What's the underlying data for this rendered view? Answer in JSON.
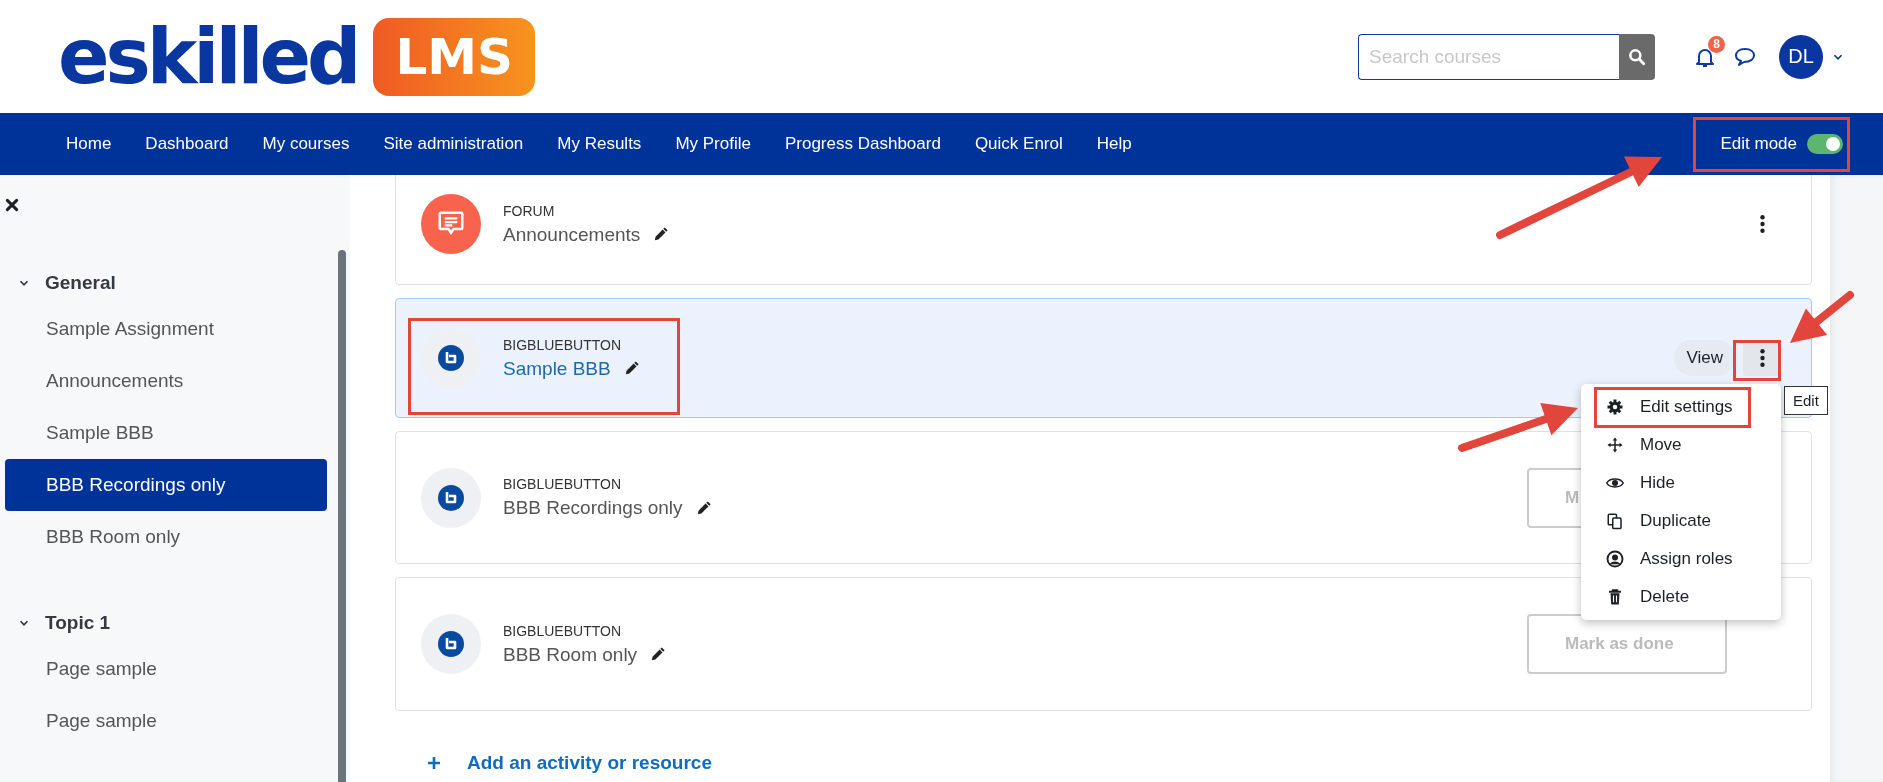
{
  "header": {
    "logo": {
      "wordmark": "eskilled",
      "badge": "LMS"
    },
    "search": {
      "placeholder": "Search courses"
    },
    "notifications": {
      "count": "8"
    },
    "user": {
      "initials": "DL"
    }
  },
  "nav": {
    "items": [
      "Home",
      "Dashboard",
      "My courses",
      "Site administration",
      "My Results",
      "My Profile",
      "Progress Dashboard",
      "Quick Enrol",
      "Help"
    ],
    "edit_mode": {
      "label": "Edit mode",
      "on": true
    }
  },
  "sidebar": {
    "sections": [
      {
        "title": "General",
        "expanded": true,
        "items": [
          {
            "label": "Sample Assignment",
            "selected": false
          },
          {
            "label": "Announcements",
            "selected": false
          },
          {
            "label": "Sample BBB",
            "selected": false
          },
          {
            "label": "BBB Recordings only",
            "selected": true
          },
          {
            "label": "BBB Room only",
            "selected": false
          }
        ]
      },
      {
        "title": "Topic 1",
        "expanded": true,
        "items": [
          {
            "label": "Page sample",
            "selected": false
          },
          {
            "label": "Page sample",
            "selected": false
          }
        ]
      }
    ]
  },
  "activities": [
    {
      "kind": "forum",
      "type": "FORUM",
      "name": "Announcements",
      "highlighted": false
    },
    {
      "kind": "bigbluebutton",
      "type": "BIGBLUEBUTTON",
      "name": "Sample BBB",
      "highlighted": true,
      "view": "View"
    },
    {
      "kind": "bigbluebutton",
      "type": "BIGBLUEBUTTON",
      "name": "BBB Recordings only",
      "highlighted": false,
      "completion": "M"
    },
    {
      "kind": "bigbluebutton",
      "type": "BIGBLUEBUTTON",
      "name": "BBB Room only",
      "highlighted": false,
      "completion": "Mark as done"
    }
  ],
  "action_menu": {
    "items": [
      {
        "kind": "settings",
        "label": "Edit settings"
      },
      {
        "kind": "move",
        "label": "Move"
      },
      {
        "kind": "hide",
        "label": "Hide"
      },
      {
        "kind": "duplicate",
        "label": "Duplicate"
      },
      {
        "kind": "roles",
        "label": "Assign roles"
      },
      {
        "kind": "delete",
        "label": "Delete"
      }
    ]
  },
  "tooltip": "Edit",
  "add_activity": "Add an activity or resource"
}
